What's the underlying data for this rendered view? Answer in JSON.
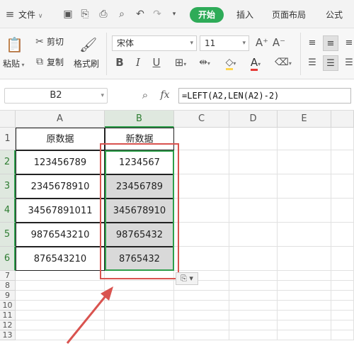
{
  "menubar": {
    "file_label": "文件",
    "tabs": [
      "开始",
      "插入",
      "页面布局",
      "公式"
    ]
  },
  "ribbon": {
    "paste_label": "粘贴",
    "cut_label": "剪切",
    "copy_label": "复制",
    "format_painter_label": "格式刷",
    "font_name": "宋体",
    "font_size": "11",
    "bold": "B",
    "italic": "I",
    "underline": "U",
    "grow_font": "A⁺",
    "shrink_font": "A⁻",
    "font_color_glyph": "A",
    "colors": {
      "accent": "#2eab58",
      "font_color": "#e53935",
      "fill_color": "#ffd54f"
    }
  },
  "formula_bar": {
    "cell_ref": "B2",
    "fx_label": "fx",
    "formula": "=LEFT(A2,LEN(A2)-2)"
  },
  "sheet": {
    "columns": [
      "A",
      "B",
      "C",
      "D",
      "E"
    ],
    "rows": [
      "1",
      "2",
      "3",
      "4",
      "5",
      "6",
      "7",
      "8",
      "9",
      "10",
      "11",
      "12",
      "13"
    ],
    "header_row": {
      "a": "原数据",
      "b": "新数据"
    },
    "data": [
      {
        "a": "123456789",
        "b": "1234567"
      },
      {
        "a": "2345678910",
        "b": "23456789"
      },
      {
        "a": "34567891011",
        "b": "345678910"
      },
      {
        "a": "9876543210",
        "b": "98765432"
      },
      {
        "a": "876543210",
        "b": "8765432"
      }
    ],
    "selected_cell": "B2",
    "highlight_color": "#d9534f"
  }
}
